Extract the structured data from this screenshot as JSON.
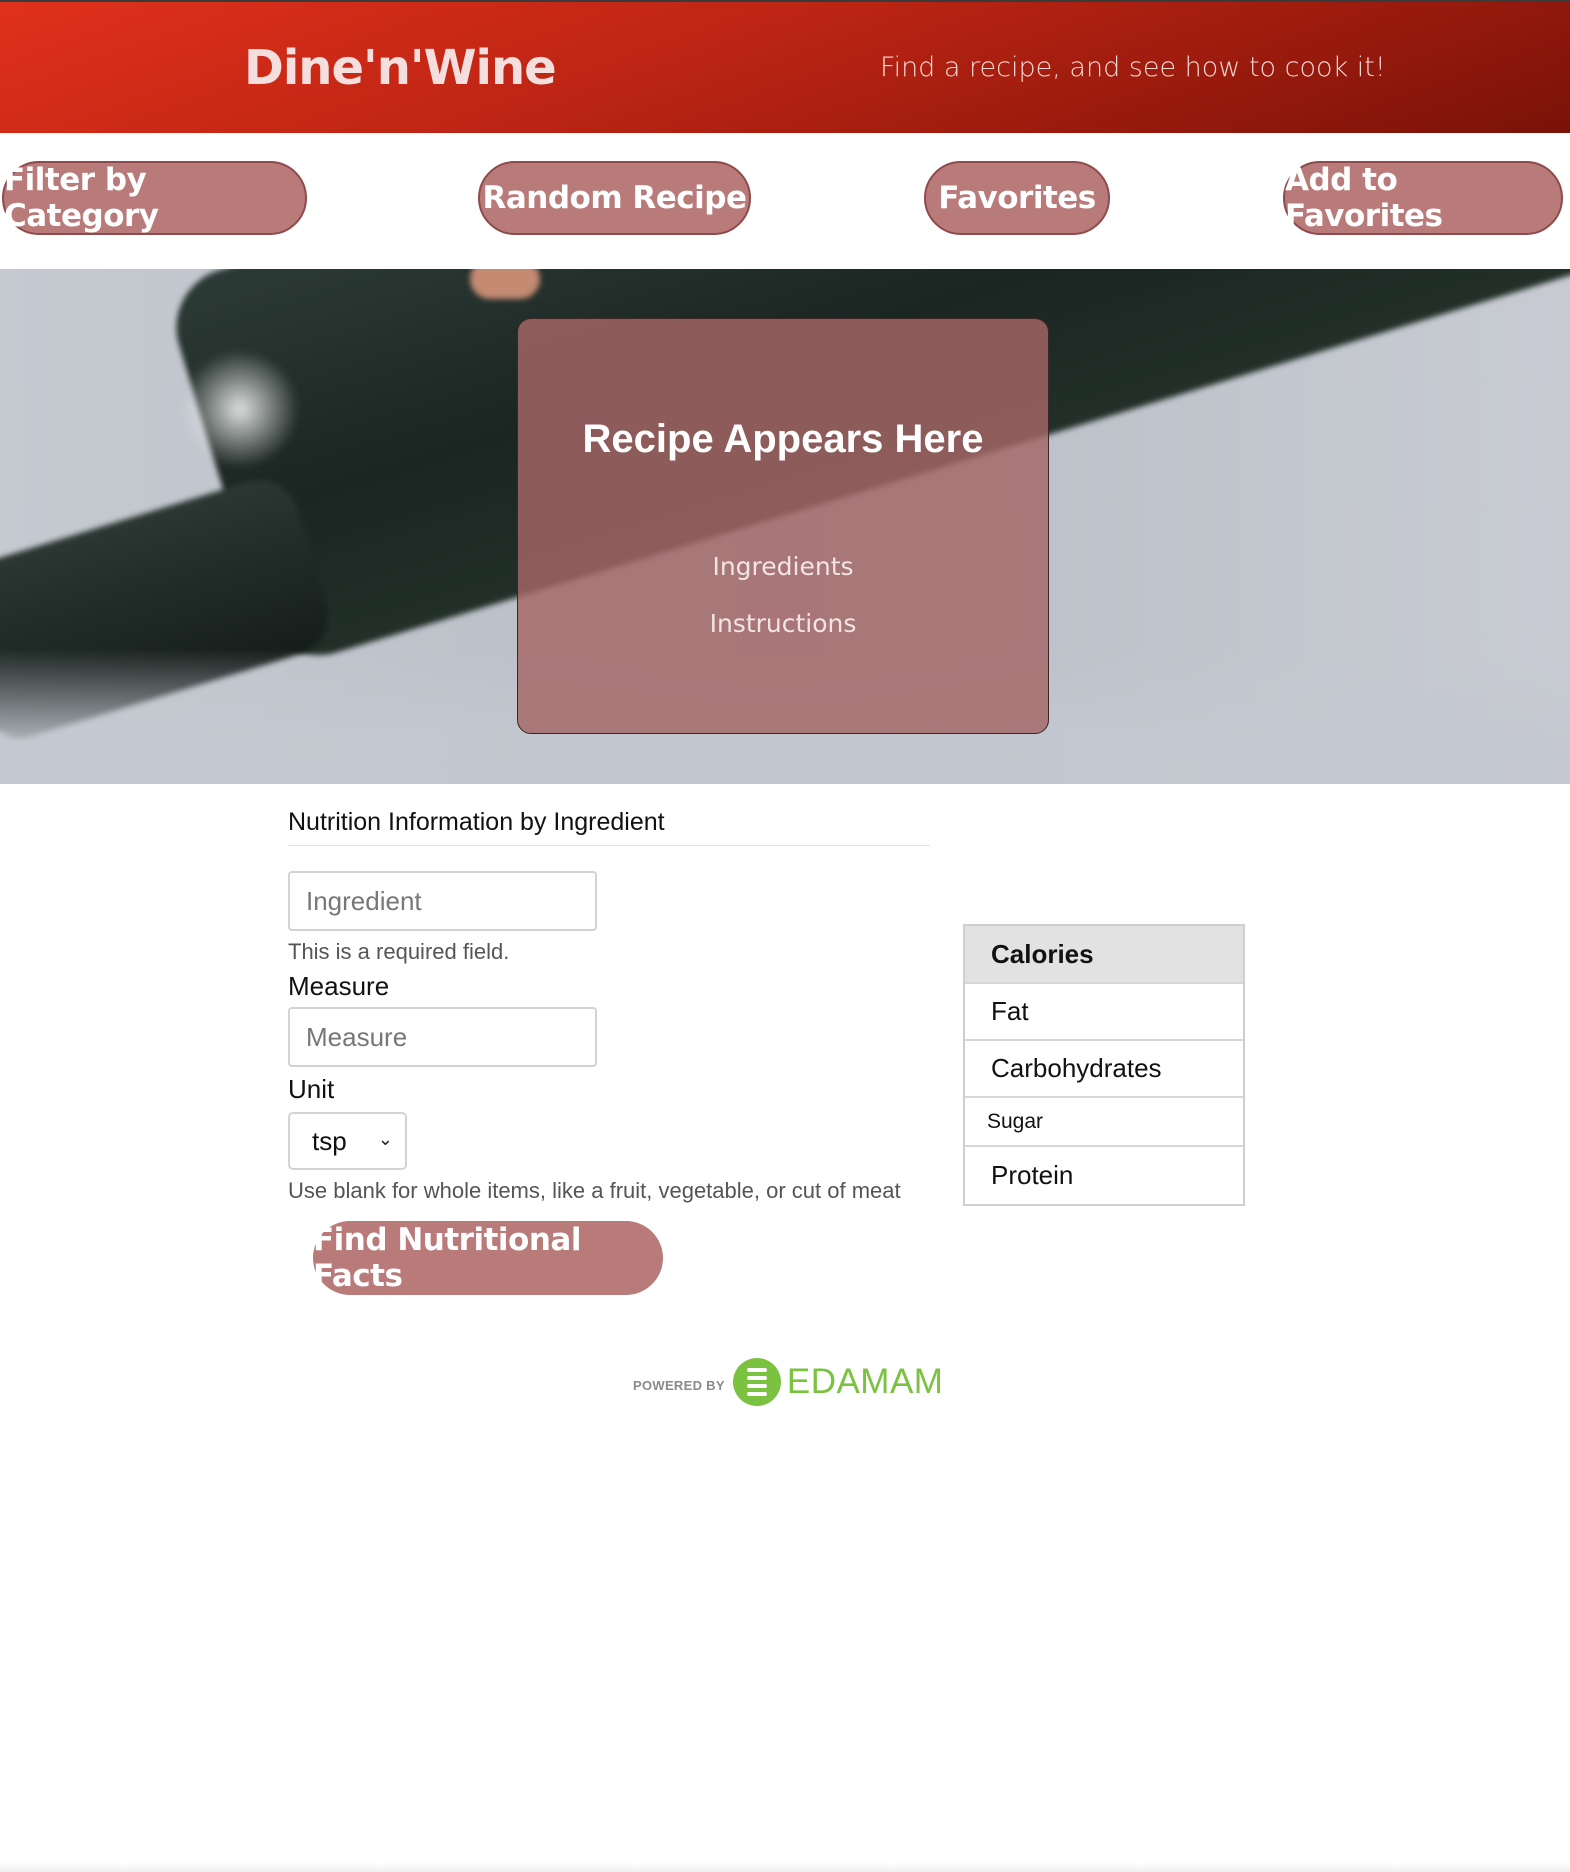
{
  "header": {
    "brand": "Dine'n'Wine",
    "tagline": "Find a recipe, and see how to cook it!"
  },
  "nav": {
    "filter_label": "Filter by Category",
    "random_label": "Random Recipe",
    "favorites_label": "Favorites",
    "add_favorites_label": "Add to Favorites"
  },
  "recipe": {
    "title": "Recipe Appears Here",
    "ingredients_label": "Ingredients",
    "instructions_label": "Instructions"
  },
  "nutrition_form": {
    "title": "Nutrition Information by Ingredient",
    "ingredient_placeholder": "Ingredient",
    "ingredient_value": "",
    "required_hint": "This is a required field.",
    "measure_label": "Measure",
    "measure_placeholder": "Measure",
    "measure_value": "",
    "unit_label": "Unit",
    "unit_selected": "tsp",
    "unit_hint": "Use blank for whole items, like a fruit, vegetable, or cut of meat",
    "submit_label": "Find Nutritional Facts"
  },
  "nutrition_table": {
    "header": "Calories",
    "rows": [
      "Fat",
      "Carbohydrates",
      "Sugar",
      "Protein"
    ]
  },
  "attribution": {
    "powered_by": "POWERED BY",
    "brand": "EDAMAM"
  },
  "colors": {
    "header_red": "#c22714",
    "button_rose": "#b97a7a",
    "edamam_green": "#7bc241"
  }
}
